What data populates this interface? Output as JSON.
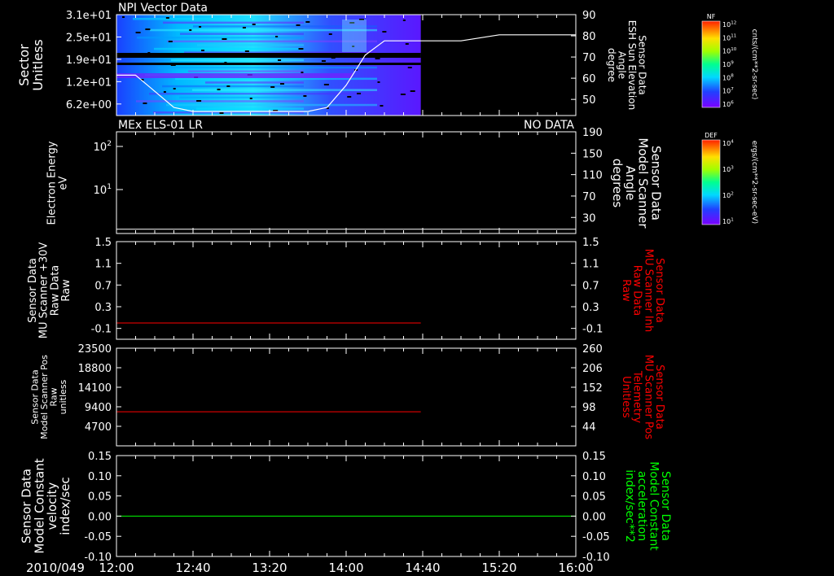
{
  "date_label": "2010/049",
  "x_tick_labels": [
    "12:00",
    "12:40",
    "13:20",
    "14:00",
    "14:40",
    "15:20",
    "16:00"
  ],
  "colors": {
    "background": "#000000",
    "axis": "#ffffff",
    "red": "#ff0000",
    "green": "#00ff00"
  },
  "colorbars": [
    {
      "label": "NF",
      "units": "cnts/(cm**2-sr-sec)",
      "tick_labels": [
        "10^12",
        "10^11",
        "10^10",
        "10^9",
        "10^8",
        "10^7",
        "10^6"
      ]
    },
    {
      "label": "DEF",
      "units": "ergs/(cm**2-sr-sec-eV)",
      "tick_labels": [
        "10^4",
        "10^3",
        "10^2",
        "10^1"
      ]
    }
  ],
  "chart_data": [
    {
      "type": "heatmap",
      "title": "NPI Vector Data",
      "ylabel": "Sector Unitless",
      "y_tick_labels": [
        "3.1e+01",
        "2.5e+01",
        "1.9e+01",
        "1.2e+01",
        "6.2e+00"
      ],
      "x_range": [
        "12:00",
        "16:00"
      ],
      "data_end": "14:39",
      "series": [
        {
          "name": "Sensor Data ESH Sun Elevation Angle degree",
          "color": "#ffffff",
          "y2_tick_labels": [
            "90",
            "80",
            "70",
            "60",
            "50"
          ],
          "ylim": [
            40,
            90
          ],
          "x": [
            "12:00",
            "12:10",
            "12:20",
            "12:30",
            "12:40",
            "13:30",
            "13:40",
            "13:50",
            "14:00",
            "14:10",
            "14:20",
            "14:30",
            "14:40",
            "15:00",
            "15:20",
            "16:00"
          ],
          "values": [
            60,
            60,
            52,
            44,
            42,
            42,
            42,
            44,
            55,
            70,
            77,
            77,
            77,
            77,
            80,
            80
          ]
        }
      ]
    },
    {
      "type": "line",
      "title": "MEx ELS-01 LR",
      "status": "NO DATA",
      "ylabel": "Electron Energy eV",
      "y_tick_labels": [
        "10^2",
        "10^1"
      ],
      "series": [
        {
          "name": "Sensor Data Model Scanner Angle degrees",
          "color": "#ffffff",
          "y2_tick_labels": [
            "190",
            "150",
            "110",
            "70",
            "30"
          ],
          "ylim": [
            0,
            190
          ],
          "x": [
            "12:00",
            "16:00"
          ],
          "values": [
            8,
            8
          ]
        }
      ]
    },
    {
      "type": "line",
      "ylabel": "Sensor Data MU Scanner +30V Raw Data Raw",
      "y_tick_labels": [
        "1.5",
        "1.1",
        "0.7",
        "0.3",
        "-0.1"
      ],
      "ylim": [
        -0.3,
        1.5
      ],
      "series": [
        {
          "name": "Sensor Data MU Scanner Inh Raw Data Raw",
          "color": "#ff0000",
          "y2_tick_labels": [
            "1.5",
            "1.1",
            "0.7",
            "0.3",
            "-0.1"
          ],
          "x": [
            "12:00",
            "14:39"
          ],
          "values": [
            0.0,
            0.0
          ]
        }
      ]
    },
    {
      "type": "line",
      "ylabel": "Sensor Data Model Scanner Pos Raw unitless",
      "y_tick_labels": [
        "23500",
        "18800",
        "14100",
        "9400",
        "4700"
      ],
      "ylim": [
        0,
        23500
      ],
      "series": [
        {
          "name": "Sensor Data MU Scanner Pos Telemetry Unitless",
          "color": "#ff0000",
          "y2_tick_labels": [
            "260",
            "206",
            "152",
            "98",
            "44"
          ],
          "x": [
            "12:00",
            "14:39"
          ],
          "values": [
            8200,
            8200
          ]
        }
      ]
    },
    {
      "type": "line",
      "ylabel": "Sensor Data Model Constant velocity index/sec",
      "y_tick_labels": [
        "0.15",
        "0.10",
        "0.05",
        "0.00",
        "-0.05",
        "-0.10"
      ],
      "ylim": [
        -0.1,
        0.15
      ],
      "series": [
        {
          "name": "Sensor Data Model Constant acceleration index/sec**2",
          "color": "#00ff00",
          "y2_tick_labels": [
            "0.15",
            "0.10",
            "0.05",
            "0.00",
            "-0.05",
            "-0.10"
          ],
          "x": [
            "12:00",
            "16:00"
          ],
          "values": [
            0.0,
            0.0
          ]
        }
      ]
    }
  ]
}
